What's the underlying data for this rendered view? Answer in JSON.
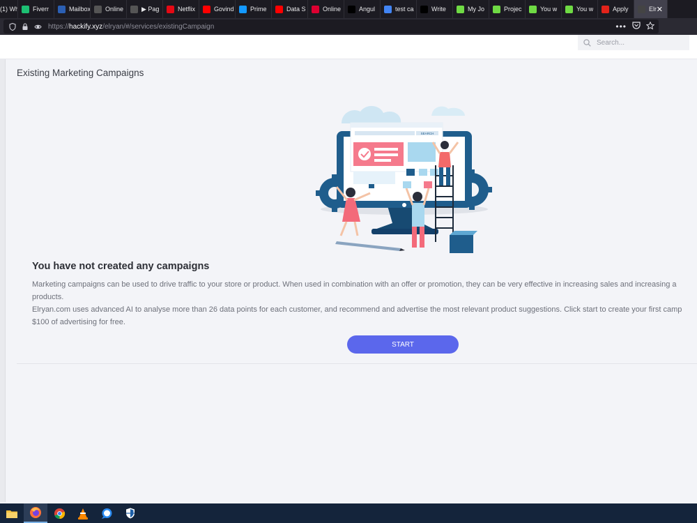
{
  "browser": {
    "tabs": [
      {
        "label": "(1) Wh",
        "icon": "whatsapp-icon",
        "color": "#25d366"
      },
      {
        "label": "Fiverr",
        "icon": "fiverr-icon",
        "color": "#1dbf73"
      },
      {
        "label": "Mailbox",
        "icon": "mailbox-icon",
        "color": "#2b5fb3"
      },
      {
        "label": "Online",
        "icon": "document-icon",
        "color": "#555555"
      },
      {
        "label": "▶ Pag",
        "icon": "document-icon",
        "color": "#555555"
      },
      {
        "label": "Netflix",
        "icon": "netflix-icon",
        "color": "#e50914"
      },
      {
        "label": "Govind",
        "icon": "youtube-icon",
        "color": "#ff0000"
      },
      {
        "label": "Prime",
        "icon": "prime-video-icon",
        "color": "#1399ff"
      },
      {
        "label": "Data S",
        "icon": "youtube-icon",
        "color": "#ff0000"
      },
      {
        "label": "Online",
        "icon": "angular-icon",
        "color": "#dd0031"
      },
      {
        "label": "Angul",
        "icon": "medium-icon",
        "color": "#000000"
      },
      {
        "label": "test ca",
        "icon": "google-icon",
        "color": "#4285f4"
      },
      {
        "label": "Write",
        "icon": "medium-icon",
        "color": "#000000"
      },
      {
        "label": "My Jo",
        "icon": "upwork-icon",
        "color": "#6fda44"
      },
      {
        "label": "Projec",
        "icon": "upwork-icon",
        "color": "#6fda44"
      },
      {
        "label": "You w",
        "icon": "upwork-icon",
        "color": "#6fda44"
      },
      {
        "label": "You w",
        "icon": "upwork-icon",
        "color": "#6fda44"
      },
      {
        "label": "Apply",
        "icon": "apply-icon",
        "color": "#e2231a"
      },
      {
        "label": "Elr",
        "icon": "elryan-icon",
        "color": "#444444"
      }
    ],
    "url_prefix": "https://",
    "url_host": "hackify.xyz",
    "url_path": "/elryan/#/services/existingCampaign"
  },
  "header": {
    "search_placeholder": "Search..."
  },
  "main": {
    "title": "Existing Marketing Campaigns",
    "illustration_label": "SEARCH",
    "empty_title": "You have not created any campaigns",
    "desc_line1": "Marketing campaigns can be used to drive traffic to your store or product. When used in combination with an offer or promotion, they can be very effective in increasing sales and increasing a",
    "desc_line2": "products.",
    "desc_line3": "Elryan.com uses advanced AI to analyse more than 26 data points for each customer, and recommend and advertise the most relevant product suggestions. Click start to create your first camp",
    "desc_line4": "$100 of advertising for free.",
    "start_label": "START"
  },
  "colors": {
    "accent": "#5b67ec",
    "monitor": "#1f5d8c",
    "pink": "#f36a7a"
  }
}
